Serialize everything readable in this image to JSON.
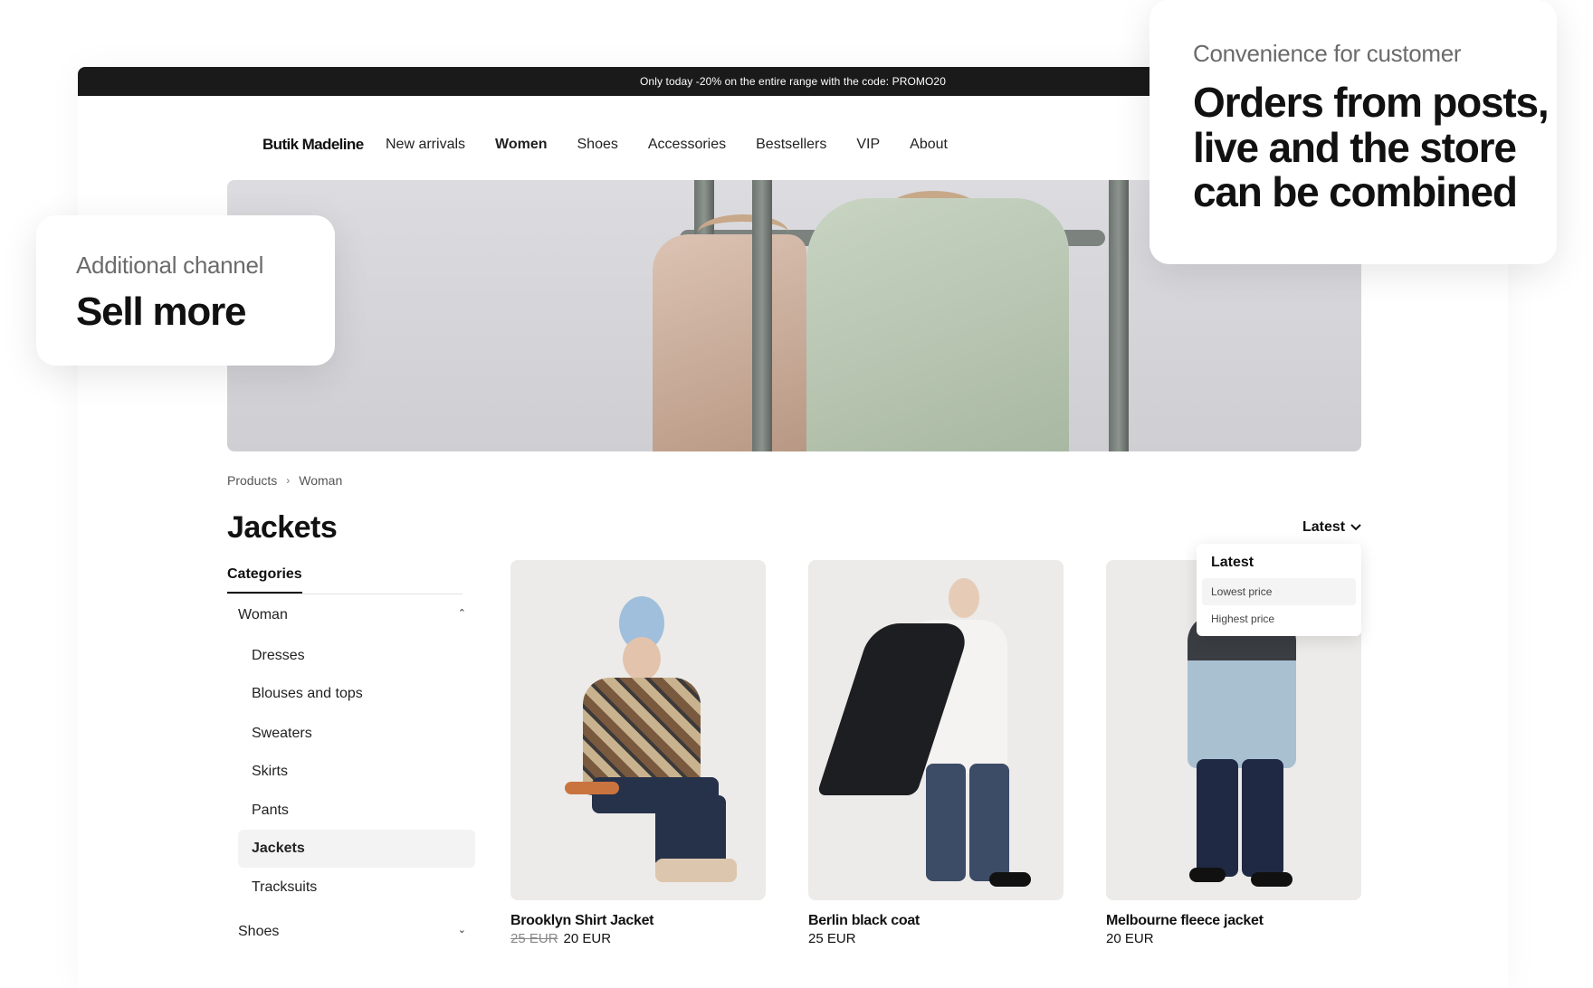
{
  "promo_bar": {
    "text": "Only today -20% on the entire range with the code: PROMO20"
  },
  "nav": {
    "brand": "Butik Madeline",
    "links": [
      {
        "label": "New arrivals",
        "active": false
      },
      {
        "label": "Women",
        "active": true
      },
      {
        "label": "Shoes",
        "active": false
      },
      {
        "label": "Accessories",
        "active": false
      },
      {
        "label": "Bestsellers",
        "active": false
      },
      {
        "label": "VIP",
        "active": false
      },
      {
        "label": "About",
        "active": false
      }
    ]
  },
  "breadcrumb": {
    "items": [
      "Products",
      "Woman"
    ]
  },
  "page_title": "Jackets",
  "sort": {
    "label": "Latest",
    "options": [
      "Latest",
      "Lowest price",
      "Highest price"
    ]
  },
  "categories": {
    "tab": "Categories",
    "group_woman": "Woman",
    "items": [
      "Dresses",
      "Blouses and tops",
      "Sweaters",
      "Skirts",
      "Pants",
      "Jackets",
      "Tracksuits"
    ],
    "active_item": "Jackets",
    "group_shoes": "Shoes"
  },
  "products": [
    {
      "name": "Brooklyn Shirt Jacket",
      "old_price": "25 EUR",
      "price": "20 EUR"
    },
    {
      "name": "Berlin black coat",
      "old_price": "",
      "price": "25 EUR"
    },
    {
      "name": "Melbourne fleece jacket",
      "old_price": "",
      "price": "20 EUR"
    }
  ],
  "card_left": {
    "kicker": "Additional channel",
    "headline": "Sell more"
  },
  "card_right": {
    "kicker": "Convenience for customer",
    "headline": "Orders from posts, live and the store can be combined"
  },
  "icons": {
    "breadcrumb_sep": "chevron-right-icon",
    "sort_toggle": "chevron-down-icon",
    "group_toggle_open": "chevron-up-icon",
    "group_toggle_closed": "chevron-down-icon"
  }
}
